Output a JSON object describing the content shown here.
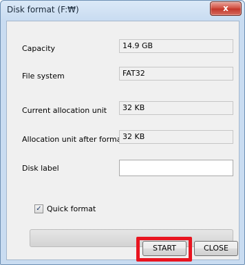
{
  "window": {
    "title": "Disk format (F:₩)",
    "close_glyph": "x"
  },
  "fields": [
    {
      "label": "Capacity",
      "value": "14.9 GB"
    },
    {
      "label": "File system",
      "value": "FAT32"
    },
    {
      "label": "Current allocation unit",
      "value": "32 KB"
    },
    {
      "label": "Allocation unit after format",
      "value": "32 KB"
    }
  ],
  "disk_label": {
    "label": "Disk label",
    "value": ""
  },
  "quick_format": {
    "label": "Quick format",
    "checked": true,
    "check_glyph": "✓"
  },
  "progress": {
    "fraction": 0
  },
  "buttons": {
    "start": "START",
    "close": "CLOSE"
  },
  "colors": {
    "highlight": "#e8141f",
    "title_close": "#c2352a"
  }
}
